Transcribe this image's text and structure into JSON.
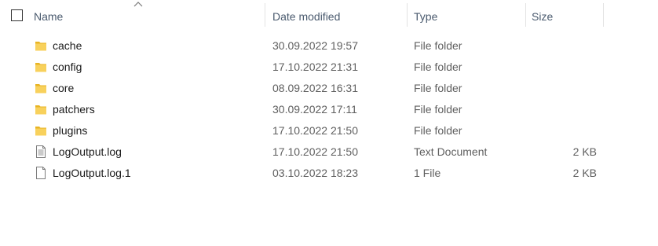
{
  "header": {
    "name_label": "Name",
    "date_label": "Date modified",
    "type_label": "Type",
    "size_label": "Size",
    "sort_icon": "chevron-up-icon"
  },
  "colors": {
    "header_text": "#4a5a6e",
    "folder_yellow": "#f5c542",
    "detail_text": "#5f5f5f"
  },
  "files": [
    {
      "name": "cache",
      "date": "30.09.2022 19:57",
      "type": "File folder",
      "size": "",
      "icon": "folder-icon"
    },
    {
      "name": "config",
      "date": "17.10.2022 21:31",
      "type": "File folder",
      "size": "",
      "icon": "folder-icon"
    },
    {
      "name": "core",
      "date": "08.09.2022 16:31",
      "type": "File folder",
      "size": "",
      "icon": "folder-icon"
    },
    {
      "name": "patchers",
      "date": "30.09.2022 17:11",
      "type": "File folder",
      "size": "",
      "icon": "folder-icon"
    },
    {
      "name": "plugins",
      "date": "17.10.2022 21:50",
      "type": "File folder",
      "size": "",
      "icon": "folder-icon"
    },
    {
      "name": "LogOutput.log",
      "date": "17.10.2022 21:50",
      "type": "Text Document",
      "size": "2 KB",
      "icon": "text-document-icon"
    },
    {
      "name": "LogOutput.log.1",
      "date": "03.10.2022 18:23",
      "type": "1 File",
      "size": "2 KB",
      "icon": "file-icon"
    }
  ]
}
